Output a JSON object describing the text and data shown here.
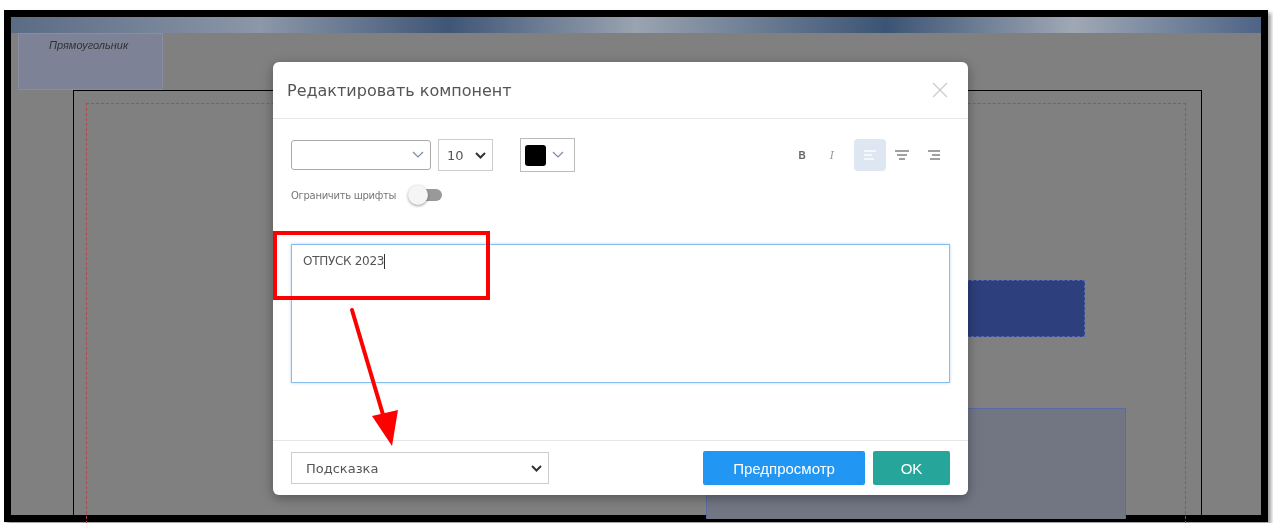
{
  "canvas": {
    "shape_label": "Прямоугольник"
  },
  "dialog": {
    "title": "Редактировать компонент",
    "toolbar": {
      "size": "10",
      "bold_label": "B",
      "italic_label": "I",
      "alignments": [
        {
          "kind": "left",
          "selected": true
        },
        {
          "kind": "center",
          "selected": false
        },
        {
          "kind": "right",
          "selected": false
        }
      ]
    },
    "restrict_fonts": {
      "label": "Ограничить шрифты",
      "on": false
    },
    "text": "ОТПУСК 2023",
    "hint_select": "Подсказка",
    "buttons": [
      {
        "kind": "preview",
        "label": "Предпросмотр"
      },
      {
        "kind": "ok",
        "label": "OK"
      }
    ]
  }
}
